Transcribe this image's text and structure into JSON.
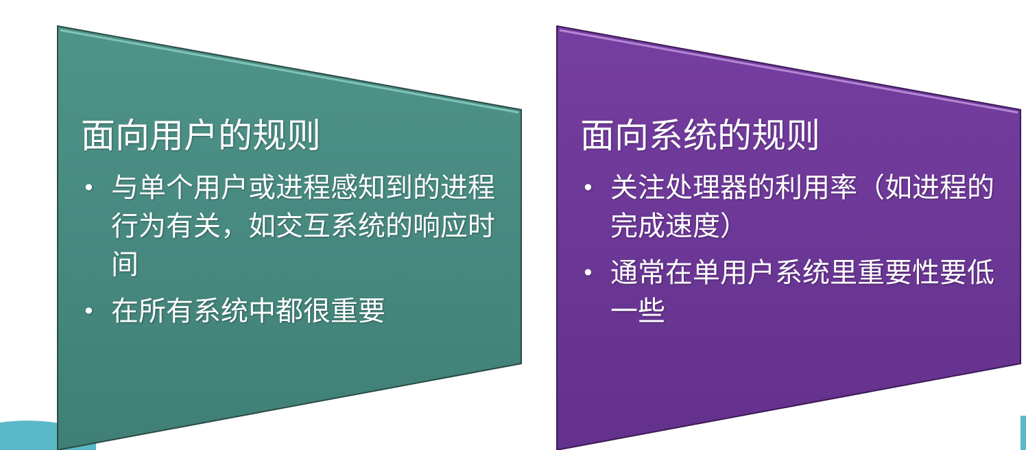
{
  "colors": {
    "panel_left": "#468a80",
    "panel_right": "#6d3798",
    "accent_teal": "#5bb8c8",
    "text": "#ffffff"
  },
  "panels": [
    {
      "title": "面向用户的规则",
      "bullets": [
        "与单个用户或进程感知到的进程行为有关，如交互系统的响应时间",
        "在所有系统中都很重要"
      ]
    },
    {
      "title": "面向系统的规则",
      "bullets": [
        "关注处理器的利用率（如进程的完成速度）",
        "通常在单用户系统里重要性要低一些"
      ]
    }
  ]
}
